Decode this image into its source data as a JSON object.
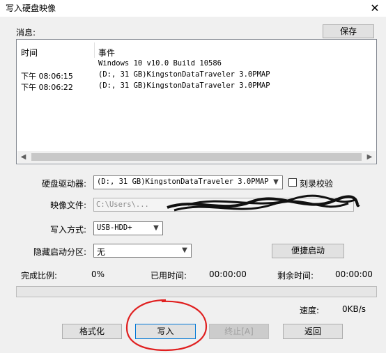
{
  "window": {
    "title": "写入硬盘映像"
  },
  "messages": {
    "label": "消息:",
    "save_label": "保存",
    "columns": [
      "时间",
      "事件"
    ],
    "rows": [
      {
        "time": "",
        "event": "Windows 10 v10.0 Build 10586"
      },
      {
        "time": "下午 08:06:15",
        "event": "(D:, 31 GB)KingstonDataTraveler 3.0PMAP"
      },
      {
        "time": "下午 08:06:22",
        "event": "(D:, 31 GB)KingstonDataTraveler 3.0PMAP"
      }
    ]
  },
  "drive": {
    "label": "硬盘驱动器:",
    "value": "(D:, 31 GB)KingstonDataTraveler 3.0PMAP",
    "verify_label": "刻录校验"
  },
  "image_file": {
    "label": "映像文件:",
    "value": "C:\\Users\\..."
  },
  "write_mode": {
    "label": "写入方式:",
    "value": "USB-HDD+"
  },
  "hidden_boot": {
    "label": "隐藏启动分区:",
    "value": "无",
    "quick_boot_label": "便捷启动"
  },
  "status": {
    "complete_label": "完成比例:",
    "complete_value": "0%",
    "elapsed_label": "已用时间:",
    "elapsed_value": "00:00:00",
    "remaining_label": "剩余时间:",
    "remaining_value": "00:00:00",
    "speed_label": "速度:",
    "speed_value": "0KB/s",
    "progress": 0
  },
  "buttons": {
    "format": "格式化",
    "write": "写入",
    "stop": "终止[A]",
    "back": "返回"
  }
}
